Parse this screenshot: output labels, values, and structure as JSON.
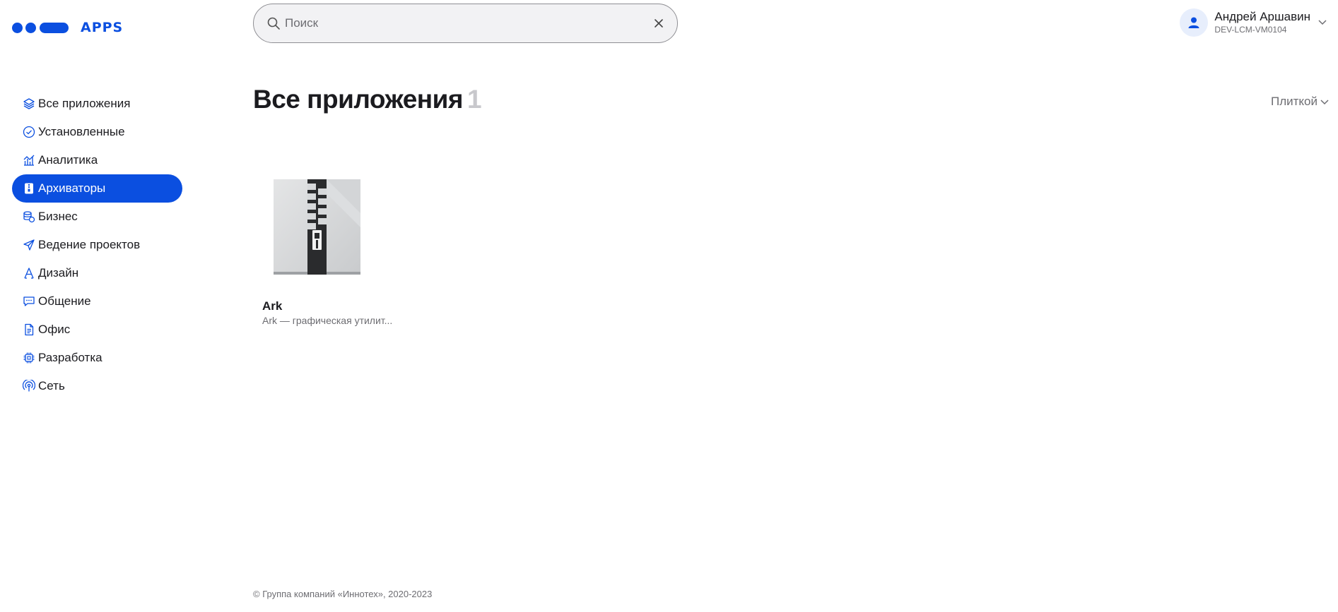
{
  "logo": {
    "text": "APPS",
    "brand_color": "#0b4fe0"
  },
  "search": {
    "placeholder": "Поиск",
    "value": ""
  },
  "user": {
    "name": "Андрей Аршавин",
    "host": "DEV-LCM-VM0104"
  },
  "sidebar": {
    "items": [
      {
        "label": "Все приложения",
        "icon": "layers-icon"
      },
      {
        "label": "Установленные",
        "icon": "check-circle-icon"
      },
      {
        "label": "Аналитика",
        "icon": "chart-icon"
      },
      {
        "label": "Архиваторы",
        "icon": "archive-icon",
        "active": true
      },
      {
        "label": "Бизнес",
        "icon": "coins-icon"
      },
      {
        "label": "Ведение проектов",
        "icon": "send-icon"
      },
      {
        "label": "Дизайн",
        "icon": "pen-icon"
      },
      {
        "label": "Общение",
        "icon": "chat-icon"
      },
      {
        "label": "Офис",
        "icon": "document-icon"
      },
      {
        "label": "Разработка",
        "icon": "chip-icon"
      },
      {
        "label": "Сеть",
        "icon": "broadcast-icon"
      }
    ]
  },
  "main": {
    "title": "Все приложения",
    "count": "1",
    "view_mode": "Плиткой",
    "apps": [
      {
        "name": "Ark",
        "description": "Ark — графическая утилит...",
        "icon": "zip-archive-icon"
      }
    ]
  },
  "footer": {
    "copyright": "© Группа компаний «Иннотех», 2020-2023"
  }
}
